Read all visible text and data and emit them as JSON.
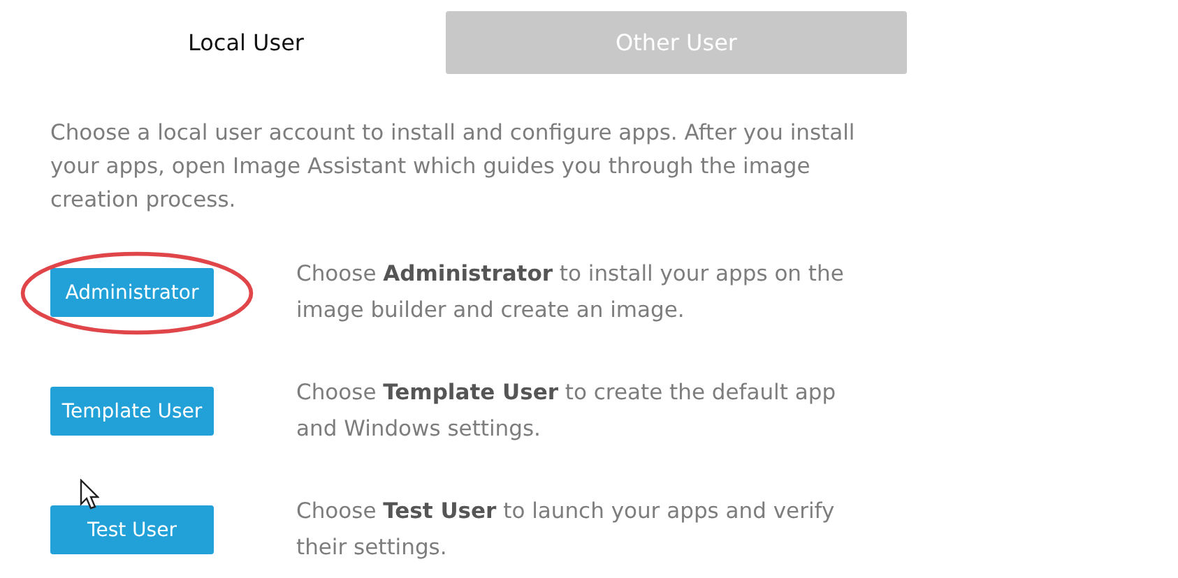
{
  "tabs": [
    {
      "label": "Local User",
      "selected": true
    },
    {
      "label": "Other User",
      "selected": false
    }
  ],
  "intro": "Choose a local user account to install and configure apps. After you install your apps, open Image Assistant which guides you through the image creation process.",
  "users": [
    {
      "button": "Administrator",
      "description": "Choose **Administrator** to install your apps on the image builder and create an image.",
      "highlighted": true
    },
    {
      "button": "Template User",
      "description": "Choose **Template User** to create the default app and Windows settings.",
      "highlighted": false
    },
    {
      "button": "Test User",
      "description": "Choose **Test User** to launch your apps and verify their settings.",
      "highlighted": false
    }
  ]
}
